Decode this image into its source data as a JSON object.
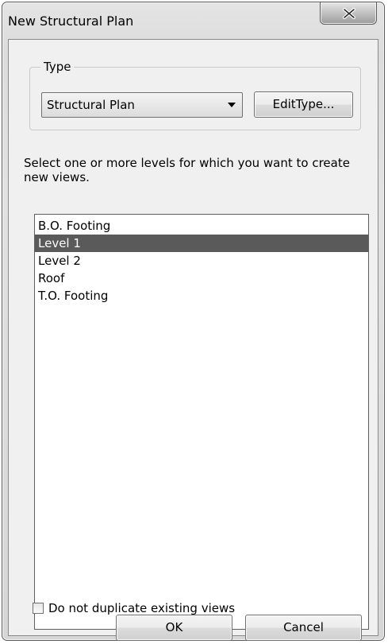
{
  "window": {
    "title": "New Structural Plan"
  },
  "type_group": {
    "label": "Type",
    "selected_type": "Structural Plan",
    "edit_type_label": "EditType..."
  },
  "instructions": "Select one or more levels for which you want to create new views.",
  "levels": [
    {
      "label": "B.O. Footing",
      "selected": false
    },
    {
      "label": "Level 1",
      "selected": true
    },
    {
      "label": "Level 2",
      "selected": false
    },
    {
      "label": "Roof",
      "selected": false
    },
    {
      "label": "T.O. Footing",
      "selected": false
    }
  ],
  "options": {
    "do_not_duplicate_label": "Do not duplicate existing views",
    "do_not_duplicate_checked": false
  },
  "buttons": {
    "ok": "OK",
    "cancel": "Cancel"
  },
  "icons": {
    "close": "close-icon",
    "dropdown": "chevron-down-icon"
  }
}
